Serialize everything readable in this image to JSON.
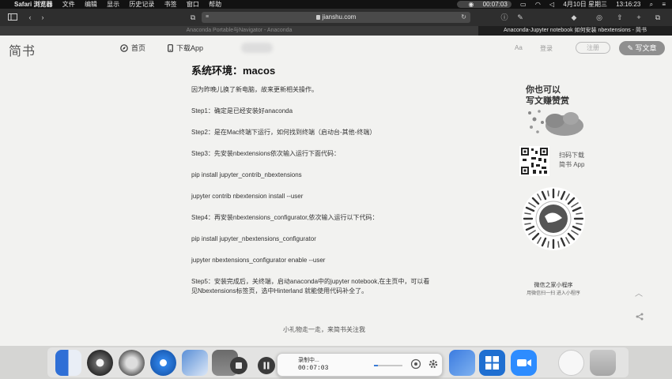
{
  "menubar": {
    "app": "Safari 浏览器",
    "items": [
      "文件",
      "编辑",
      "显示",
      "历史记录",
      "书签",
      "窗口",
      "帮助"
    ],
    "recording": "00:07:03",
    "date": "4月10日 星期三",
    "time": "13:16:23"
  },
  "address": {
    "url": "jianshu.com"
  },
  "tabs": [
    {
      "label": "Anaconda Portable与Navigator - Anaconda"
    },
    {
      "label": "Anaconda-Jupyter notebook 如何安装 nbextensions - 简书"
    }
  ],
  "nav": {
    "logo": "简书",
    "home": "首页",
    "app": "下载App",
    "aa": "Aa",
    "login": "登录",
    "register": "注册",
    "write": "写文章"
  },
  "article": {
    "heading": "系统环境：macos",
    "paragraphs": [
      "因为昨晚儿换了新电脑，故来更新相关操作。",
      "Step1：确定是已经安装好anaconda",
      "Step2：是在Mac终端下运行，如何找到终端（启动台-其他-终端）",
      "Step3：先安装nbextensions依次输入运行下面代码：",
      "pip install jupyter_contrib_nbextensions",
      "jupyter contrib nbextension install --user",
      "Step4：再安装nbextensions_configurator,依次输入运行以下代码：",
      "pip install jupyter_nbextensions_configurator",
      "jupyter nbextensions_configurator enable --user",
      "Step5：安装完成后，关终端，启动anaconda中的jupyter notebook,在主页中，可以看见Nbextensions标签页，选中Hinterland 就能使用代码补全了。"
    ],
    "reward": "小礼物走一走，来简书关注我"
  },
  "sidebar": {
    "promo_line1": "你也可以",
    "promo_line2": "写文赚赞赏",
    "download_line1": "扫码下载",
    "download_line2": "简书 App",
    "mini_title": "微信之家小程序",
    "mini_sub": "用微信扫一扫 进入小程序"
  },
  "recorder": {
    "label": "录制中...",
    "time": "00:07:03",
    "volume": 0.15
  },
  "colors": {
    "menubar": "#121212",
    "toolbar": "#2e2e2e",
    "page": "#f2f2f0",
    "write_button": "#8f8f8f",
    "accent": "#3a7bd5"
  }
}
